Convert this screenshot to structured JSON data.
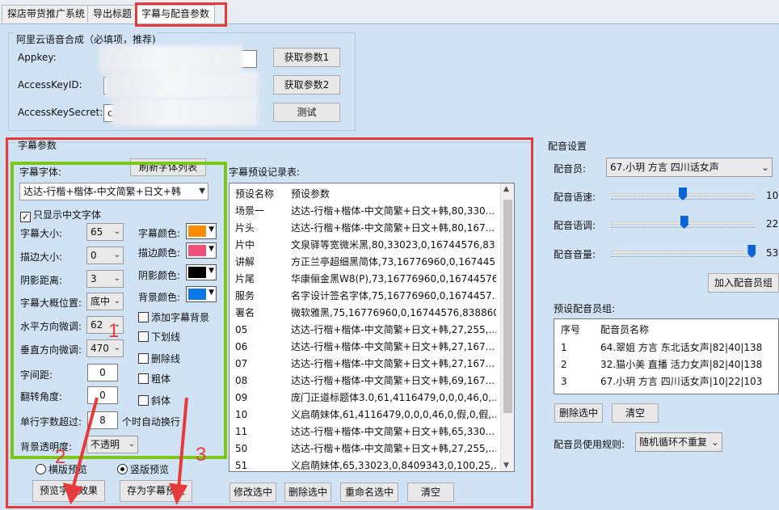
{
  "tabs": [
    {
      "label": "探店带货推广系统",
      "active": false
    },
    {
      "label": "导出标题",
      "active": false
    },
    {
      "label": "字幕与配音参数",
      "active": true
    }
  ],
  "aliyun": {
    "group_title": "阿里云语音合成（必填项，推荐)",
    "appkey_label": "Appkey:",
    "accesskeyid_label": "AccessKeyID:",
    "accesskeysecret_label": "AccessKeySecret:",
    "secret_prefix": "c",
    "btn_get1": "获取参数1",
    "btn_get2": "获取参数2",
    "btn_test": "测试"
  },
  "subtitle": {
    "group_title": "字幕参数",
    "font_label": "字幕字体:",
    "refresh_btn": "刷新字体列表",
    "font_value": "达达-行楷+楷体-中文简繁+日文+韩",
    "only_chinese": "只显示中文字体",
    "only_chinese_checked": true,
    "size_label": "字幕大小:",
    "size_value": "65",
    "stroke_label": "描边大小:",
    "stroke_value": "0",
    "shadow_label": "阴影距离:",
    "shadow_value": "3",
    "position_label": "字幕大概位置:",
    "position_value": "底中",
    "hadjust_label": "水平方向微调:",
    "hadjust_value": "62",
    "vadjust_label": "垂直方向微调:",
    "vadjust_value": "470",
    "spacing_label": "字间距:",
    "spacing_value": "0",
    "rotate_label": "翻转角度:",
    "rotate_value": "0",
    "wrap_label": "单行字数超过:",
    "wrap_value": "8",
    "wrap_suffix": "个时自动换行",
    "bgalpha_label": "背景透明度:",
    "bgalpha_value": "不透明",
    "color_label": "字幕颜色:",
    "color_value": "#ff8c00",
    "stroke_color_label": "描边颜色:",
    "stroke_color_value": "#f0507a",
    "shadow_color_label": "阴影颜色:",
    "shadow_color_value": "#000000",
    "bg_color_label": "背景颜色:",
    "bg_color_value": "#0a78e6",
    "add_bg": "添加字幕背景",
    "underline": "下划线",
    "strikethrough": "删除线",
    "bold": "粗体",
    "italic": "斜体",
    "radio_horizontal": "横版预览",
    "radio_vertical": "竖版预览",
    "vertical_selected": true,
    "preview_btn": "预览字幕效果",
    "save_btn": "存为字幕预设"
  },
  "presets": {
    "title": "字幕预设记录表:",
    "col_name": "预设名称",
    "col_params": "预设参数",
    "rows": [
      {
        "name": "场景一",
        "params": "达达-行楷+楷体-中文简繁+日文+韩,80,330..."
      },
      {
        "name": "片头",
        "params": "达达-行楷+楷体-中文简繁+日文+韩,80,167..."
      },
      {
        "name": "片中",
        "params": "文泉驿等宽微米黑,80,33023,0,16744576,83..."
      },
      {
        "name": "讲解",
        "params": "方正兰亭超细黑简体,73,16776960,0,167445..."
      },
      {
        "name": "片尾",
        "params": "华康俪金黑W8(P),73,16776960,0,16744576..."
      },
      {
        "name": "服务",
        "params": "名字设计签名字体,75,16776960,0,1674457..."
      },
      {
        "name": "署名",
        "params": "微软雅黑,75,16776960,0,16744576,838860..."
      },
      {
        "name": "05",
        "params": "达达-行楷+楷体-中文简繁+日文+韩,27,255,..."
      },
      {
        "name": "06",
        "params": "达达-行楷+楷体-中文简繁+日文+韩,27,167..."
      },
      {
        "name": "07",
        "params": "达达-行楷+楷体-中文简繁+日文+韩,27,167..."
      },
      {
        "name": "08",
        "params": "达达-行楷+楷体-中文简繁+日文+韩,69,167..."
      },
      {
        "name": "09",
        "params": "庞门正道标题体3.0,61,4116479,0,0,0,46,0,..."
      },
      {
        "name": "10",
        "params": "义启萌妹体,61,4116479,0,0,0,46,0,假,0,假,..."
      },
      {
        "name": "11",
        "params": "达达-行楷+楷体-中文简繁+日文+韩,65,330..."
      },
      {
        "name": "50",
        "params": "达达-行楷+楷体-中文简繁+日文+韩,27,255,..."
      },
      {
        "name": "51",
        "params": "义启萌妹体,65,33023,0,8409343,0,100,25,..."
      }
    ],
    "btn_modify": "修改选中",
    "btn_delete": "删除选中",
    "btn_rename": "重命名选中",
    "btn_clear": "清空"
  },
  "voice": {
    "group_title": "配音设置",
    "speaker_label": "配音员:",
    "speaker_value": "67.小玥 方言 四川话女声",
    "speed_label": "配音语速:",
    "speed_value": "10",
    "speed_fraction": 0.5,
    "pitch_label": "配音语调:",
    "pitch_value": "22",
    "pitch_fraction": 0.51,
    "volume_label": "配音音量:",
    "volume_value": "53",
    "volume_fraction": 0.98,
    "add_btn": "加入配音员组",
    "group_list_title": "预设配音员组:",
    "col_no": "序号",
    "col_name": "配音员名称",
    "members": [
      {
        "no": "1",
        "name": "64.翠姐 方言 东北话女声|82|40|138"
      },
      {
        "no": "2",
        "name": "32.猫小美 直播 活力女声|82|40|138"
      },
      {
        "no": "3",
        "name": "67.小玥 方言 四川话女声|10|22|103"
      }
    ],
    "del_btn": "删除选中",
    "clear_btn": "清空",
    "rule_label": "配音员使用规则:",
    "rule_value": "随机循环不重复"
  },
  "annotations": {
    "n1": "1",
    "n2": "2",
    "n3": "3"
  }
}
